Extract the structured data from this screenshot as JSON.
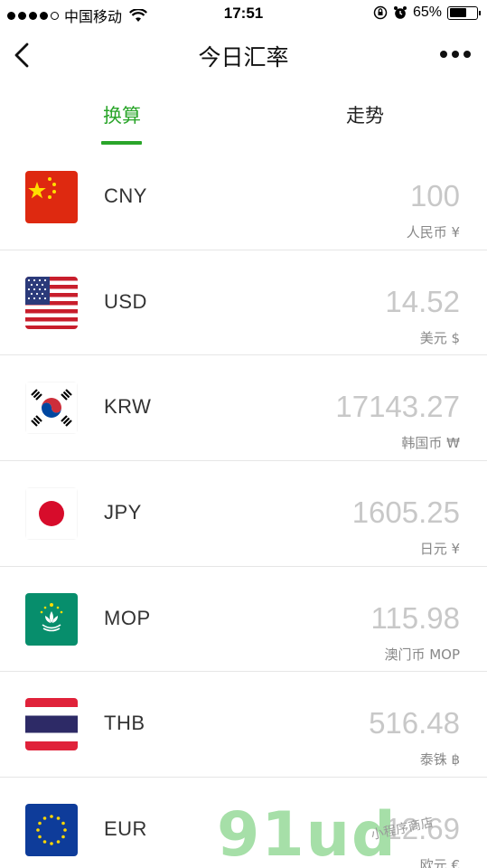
{
  "status": {
    "carrier": "中国移动",
    "time": "17:51",
    "battery": "65%",
    "battery_level": 0.65,
    "signal_bars": 4
  },
  "nav": {
    "title": "今日汇率"
  },
  "tabs": [
    {
      "label": "换算",
      "active": true
    },
    {
      "label": "走势",
      "active": false
    }
  ],
  "rows": [
    {
      "code": "CNY",
      "amount": "100",
      "unit": "人民币 ¥",
      "flag": "china-flag-icon"
    },
    {
      "code": "USD",
      "amount": "14.52",
      "unit": "美元 $",
      "flag": "usa-flag-icon"
    },
    {
      "code": "KRW",
      "amount": "17143.27",
      "unit": "韩国币 ₩",
      "flag": "korea-flag-icon"
    },
    {
      "code": "JPY",
      "amount": "1605.25",
      "unit": "日元 ¥",
      "flag": "japan-flag-icon"
    },
    {
      "code": "MOP",
      "amount": "115.98",
      "unit": "澳门币 MOP",
      "flag": "macau-flag-icon"
    },
    {
      "code": "THB",
      "amount": "516.48",
      "unit": "泰铢 ฿",
      "flag": "thailand-flag-icon"
    },
    {
      "code": "EUR",
      "amount": "12.69",
      "unit": "欧元 €",
      "flag": "eu-flag-icon"
    }
  ],
  "watermark": {
    "text": "91ud",
    "sub": "小程序商店"
  },
  "colors": {
    "accent": "#2aa52a",
    "amount": "#c8c8c8",
    "divider": "#e6e6e6"
  }
}
